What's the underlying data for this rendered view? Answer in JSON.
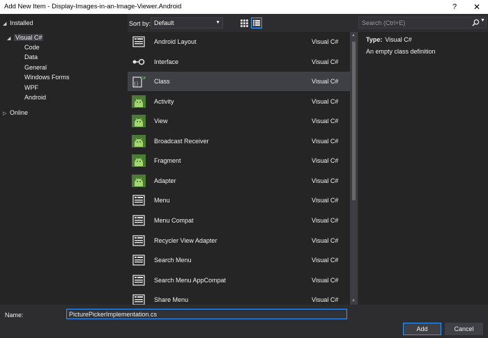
{
  "window": {
    "title": "Add New Item - Display-Images-in-an-Image-Viewer.Android",
    "help": "?",
    "close": "✕"
  },
  "tree": {
    "installed": "Installed",
    "visual_csharp": "Visual C#",
    "children": [
      "Code",
      "Data",
      "General",
      "Windows Forms",
      "WPF",
      "Android"
    ],
    "online": "Online"
  },
  "sort": {
    "label": "Sort by:",
    "value": "Default"
  },
  "search": {
    "placeholder": "Search (Ctrl+E)"
  },
  "items": [
    {
      "name": "Android Layout",
      "lang": "Visual C#",
      "icon": "layout-icon"
    },
    {
      "name": "Interface",
      "lang": "Visual C#",
      "icon": "interface-icon"
    },
    {
      "name": "Class",
      "lang": "Visual C#",
      "icon": "class-icon",
      "selected": true
    },
    {
      "name": "Activity",
      "lang": "Visual C#",
      "icon": "android-icon"
    },
    {
      "name": "View",
      "lang": "Visual C#",
      "icon": "android-icon"
    },
    {
      "name": "Broadcast Receiver",
      "lang": "Visual C#",
      "icon": "android-icon"
    },
    {
      "name": "Fragment",
      "lang": "Visual C#",
      "icon": "android-icon"
    },
    {
      "name": "Adapter",
      "lang": "Visual C#",
      "icon": "android-icon"
    },
    {
      "name": "Menu",
      "lang": "Visual C#",
      "icon": "layout-icon"
    },
    {
      "name": "Menu Compat",
      "lang": "Visual C#",
      "icon": "layout-icon"
    },
    {
      "name": "Recycler View Adapter",
      "lang": "Visual C#",
      "icon": "layout-icon"
    },
    {
      "name": "Search Menu",
      "lang": "Visual C#",
      "icon": "layout-icon"
    },
    {
      "name": "Search Menu AppCompat",
      "lang": "Visual C#",
      "icon": "layout-icon"
    },
    {
      "name": "Share Menu",
      "lang": "Visual C#",
      "icon": "layout-icon"
    }
  ],
  "detail": {
    "type_label": "Type:",
    "type_value": "Visual C#",
    "description": "An empty class definition"
  },
  "name_field": {
    "label": "Name:",
    "value": "PicturePickerImplementation.cs"
  },
  "buttons": {
    "add": "Add",
    "cancel": "Cancel"
  },
  "colors": {
    "accent": "#3399ff",
    "android": "#78c257",
    "background": "#252526"
  }
}
